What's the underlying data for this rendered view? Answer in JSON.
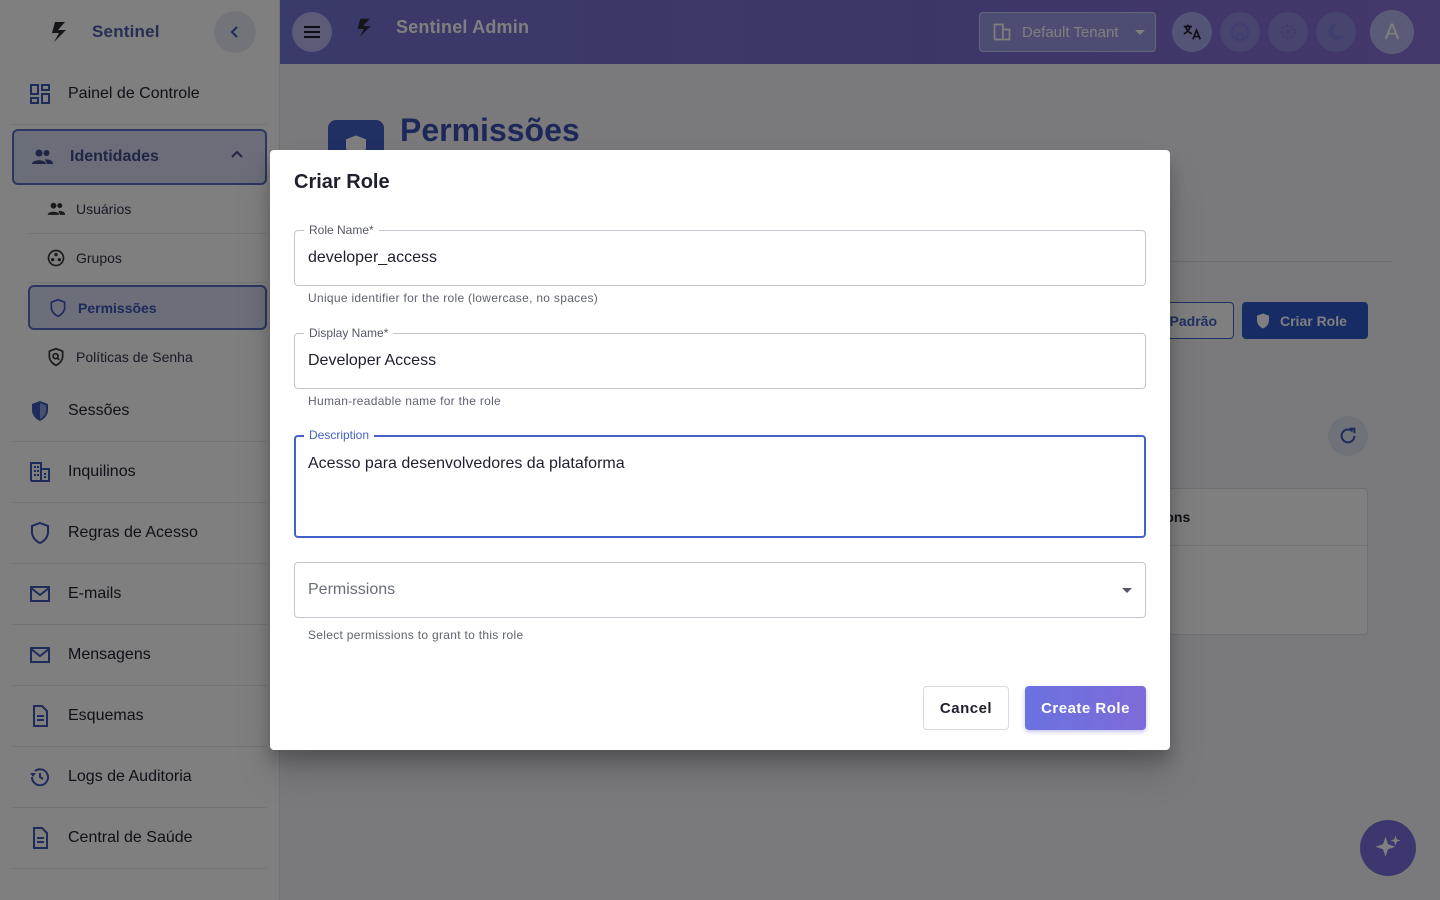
{
  "app": {
    "brand": "Sentinel",
    "admin_title": "Sentinel Admin"
  },
  "sidebar": {
    "items": [
      {
        "label": "Painel de Controle",
        "icon": "dashboard-icon"
      },
      {
        "label": "Identidades",
        "icon": "people-icon",
        "expanded": true
      },
      {
        "label": "Sessões",
        "icon": "shield-icon"
      },
      {
        "label": "Inquilinos",
        "icon": "building-icon"
      },
      {
        "label": "Regras de Acesso",
        "icon": "shield-outline-icon"
      },
      {
        "label": "E-mails",
        "icon": "mail-icon"
      },
      {
        "label": "Mensagens",
        "icon": "mail-icon"
      },
      {
        "label": "Esquemas",
        "icon": "document-icon"
      },
      {
        "label": "Logs de Auditoria",
        "icon": "history-icon"
      },
      {
        "label": "Central de Saúde",
        "icon": "document-icon"
      }
    ],
    "subitems": [
      {
        "label": "Usuários",
        "icon": "people-icon"
      },
      {
        "label": "Grupos",
        "icon": "groups-icon"
      },
      {
        "label": "Permissões",
        "icon": "shield-outline-icon",
        "active": true
      },
      {
        "label": "Políticas de Senha",
        "icon": "policy-icon"
      }
    ]
  },
  "header": {
    "tenant": "Default Tenant",
    "avatar_initial": "A"
  },
  "page": {
    "title": "Permissões",
    "btn_default_partial": "Padrão",
    "btn_create": "Criar Role",
    "table_header_partial": "ctions"
  },
  "dialog": {
    "title": "Criar Role",
    "role_name": {
      "label": "Role Name",
      "required": "*",
      "value": "developer_access",
      "helper": "Unique identifier for the role (lowercase, no spaces)"
    },
    "display_name": {
      "label": "Display Name",
      "required": "*",
      "value": "Developer Access",
      "helper": "Human-readable name for the role"
    },
    "description": {
      "label": "Description",
      "value": "Acesso para desenvolvedores da plataforma"
    },
    "permissions": {
      "label": "Permissions",
      "helper": "Select permissions to grant to this role"
    },
    "cancel": "Cancel",
    "create": "Create Role"
  },
  "colors": {
    "primary": "#4361c6",
    "appbar_gradient_start": "#7474d6",
    "appbar_gradient_end": "#8a6fd4",
    "create_button": "#6a72e0"
  }
}
